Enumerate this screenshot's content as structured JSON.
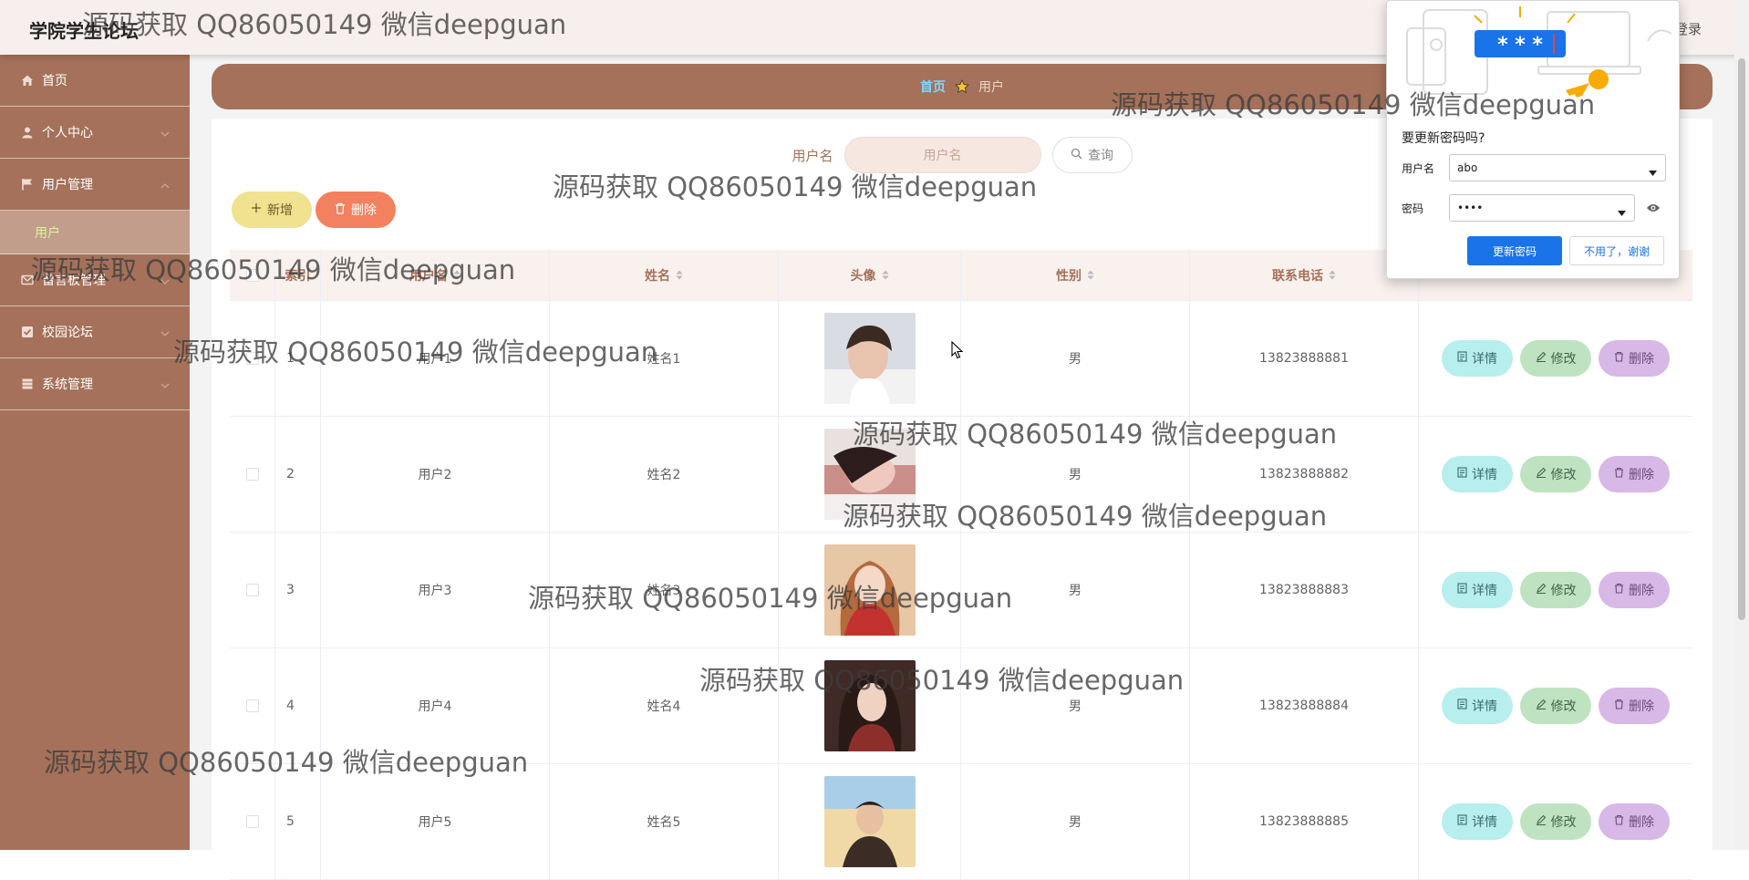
{
  "header": {
    "title": "学院学生论坛",
    "logout_label": "登录"
  },
  "sidebar": {
    "items": [
      {
        "label": "首页",
        "icon": "home-icon"
      },
      {
        "label": "个人中心",
        "icon": "user-icon"
      },
      {
        "label": "用户管理",
        "icon": "flag-icon",
        "expanded": true,
        "children": [
          {
            "label": "用户"
          }
        ]
      },
      {
        "label": "留言板管理",
        "icon": "message-icon"
      },
      {
        "label": "校园论坛",
        "icon": "checkbox-icon"
      },
      {
        "label": "系统管理",
        "icon": "settings-icon"
      }
    ]
  },
  "breadcrumb": {
    "home": "首页",
    "current": "用户"
  },
  "search": {
    "label": "用户名",
    "placeholder": "用户名",
    "button_label": "查询"
  },
  "actions": {
    "add_label": "新增",
    "delete_label": "删除"
  },
  "table": {
    "columns": [
      "索引",
      "用户名",
      "姓名",
      "头像",
      "性别",
      "联系电话"
    ],
    "rows": [
      {
        "index": "1",
        "username": "用户1",
        "name": "姓名1",
        "sex": "男",
        "phone": "13823888881"
      },
      {
        "index": "2",
        "username": "用户2",
        "name": "姓名2",
        "sex": "男",
        "phone": "13823888882"
      },
      {
        "index": "3",
        "username": "用户3",
        "name": "姓名3",
        "sex": "男",
        "phone": "13823888883"
      },
      {
        "index": "4",
        "username": "用户4",
        "name": "姓名4",
        "sex": "男",
        "phone": "13823888884"
      },
      {
        "index": "5",
        "username": "用户5",
        "name": "姓名5",
        "sex": "男",
        "phone": "13823888885"
      }
    ],
    "row_actions": {
      "detail": "详情",
      "edit": "修改",
      "delete": "删除"
    }
  },
  "password_popup": {
    "masked_banner": "* * *",
    "title": "要更新密码吗?",
    "username_label": "用户名",
    "username_value": "abo",
    "password_label": "密码",
    "password_value": "••••",
    "update_button": "更新密码",
    "dismiss_button": "不用了，谢谢"
  },
  "watermark": "源码获取 QQ86050149 微信deepguan",
  "colors": {
    "sidebar": "#a5715a",
    "accent_link": "#7fd8ff",
    "add_button": "#f0e28e",
    "delete_button": "#f3805e",
    "primary_blue": "#1a73e8"
  }
}
